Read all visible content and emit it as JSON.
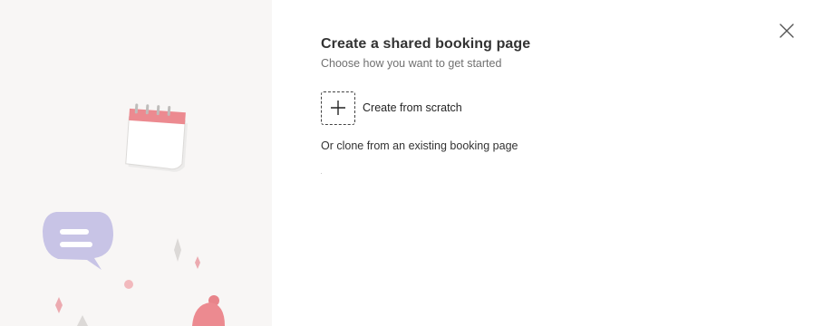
{
  "dialog": {
    "title": "Create a shared booking page",
    "subtitle": "Choose how you want to get started",
    "options": {
      "scratch_label": "Create from scratch",
      "clone_label": "Or clone from an existing booking page"
    }
  },
  "icons": {
    "close": "close-icon",
    "add": "plus-icon"
  },
  "colors": {
    "left_panel_bg": "#f8f6f5",
    "calendar_accent": "#e8848a",
    "chat_bubble": "#c8c4e6",
    "sparkle": "#ecaab0"
  }
}
